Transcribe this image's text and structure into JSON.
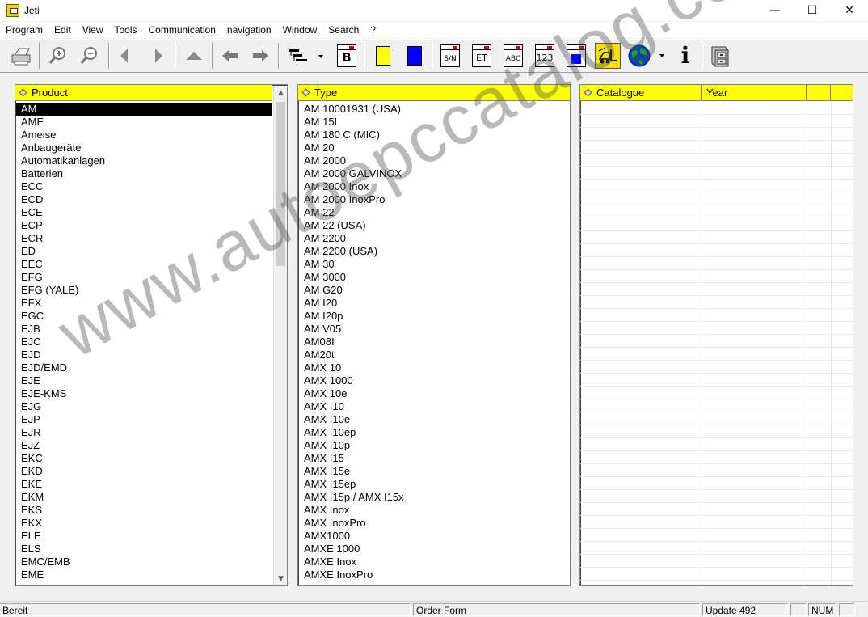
{
  "window": {
    "title": "Jeti",
    "minimize": "—",
    "maximize": "☐",
    "close": "✕"
  },
  "menu": [
    "Program",
    "Edit",
    "View",
    "Tools",
    "Communication",
    "navigation",
    "Window",
    "Search",
    "?"
  ],
  "toolbar": {
    "catalog_sn": "S/N",
    "catalog_et": "ET",
    "catalog_abc": "ABC",
    "catalog_123": "123",
    "book_b": "B",
    "info": "i",
    "colors": {
      "yellow": "#ffff00",
      "blue": "#0000ff"
    }
  },
  "product_panel": {
    "header": "Product",
    "selected_index": 0,
    "items": [
      "AM",
      "AME",
      "Ameise",
      "Anbaugeräte",
      "Automatikanlagen",
      "Batterien",
      "ECC",
      "ECD",
      "ECE",
      "ECP",
      "ECR",
      "ED",
      "EEC",
      "EFG",
      "EFG (YALE)",
      "EFX",
      "EGC",
      "EJB",
      "EJC",
      "EJD",
      "EJD/EMD",
      "EJE",
      "EJE-KMS",
      "EJG",
      "EJP",
      "EJR",
      "EJZ",
      "EKC",
      "EKD",
      "EKE",
      "EKM",
      "EKS",
      "EKX",
      "ELE",
      "ELS",
      "EMC/EMB",
      "EME"
    ]
  },
  "type_panel": {
    "header": "Type",
    "items": [
      "AM 10001931 (USA)",
      "AM 15L",
      "AM 180 C (MIC)",
      "AM 20",
      "AM 2000",
      "AM 2000 GALVINOX",
      "AM 2000 Inox",
      "AM 2000 InoxPro",
      "AM 22",
      "AM 22 (USA)",
      "AM 2200",
      "AM 2200 (USA)",
      "AM 30",
      "AM 3000",
      "AM G20",
      "AM I20",
      "AM I20p",
      "AM V05",
      "AM08I",
      "AM20t",
      "AMX 10",
      "AMX 1000",
      "AMX 10e",
      "AMX I10",
      "AMX I10e",
      "AMX I10ep",
      "AMX I10p",
      "AMX I15",
      "AMX I15e",
      "AMX I15ep",
      "AMX I15p / AMX I15x",
      "AMX Inox",
      "AMX InoxPro",
      "AMX1000",
      "AMXE 1000",
      "AMXE Inox",
      "AMXE InoxPro"
    ]
  },
  "catalogue_panel": {
    "col_catalogue": "Catalogue",
    "col_year": "Year"
  },
  "status": {
    "ready": "Bereit",
    "order_form": "Order Form",
    "update": "Update 492",
    "num": "NUM"
  },
  "watermark": "www.autoepccatalog.com"
}
